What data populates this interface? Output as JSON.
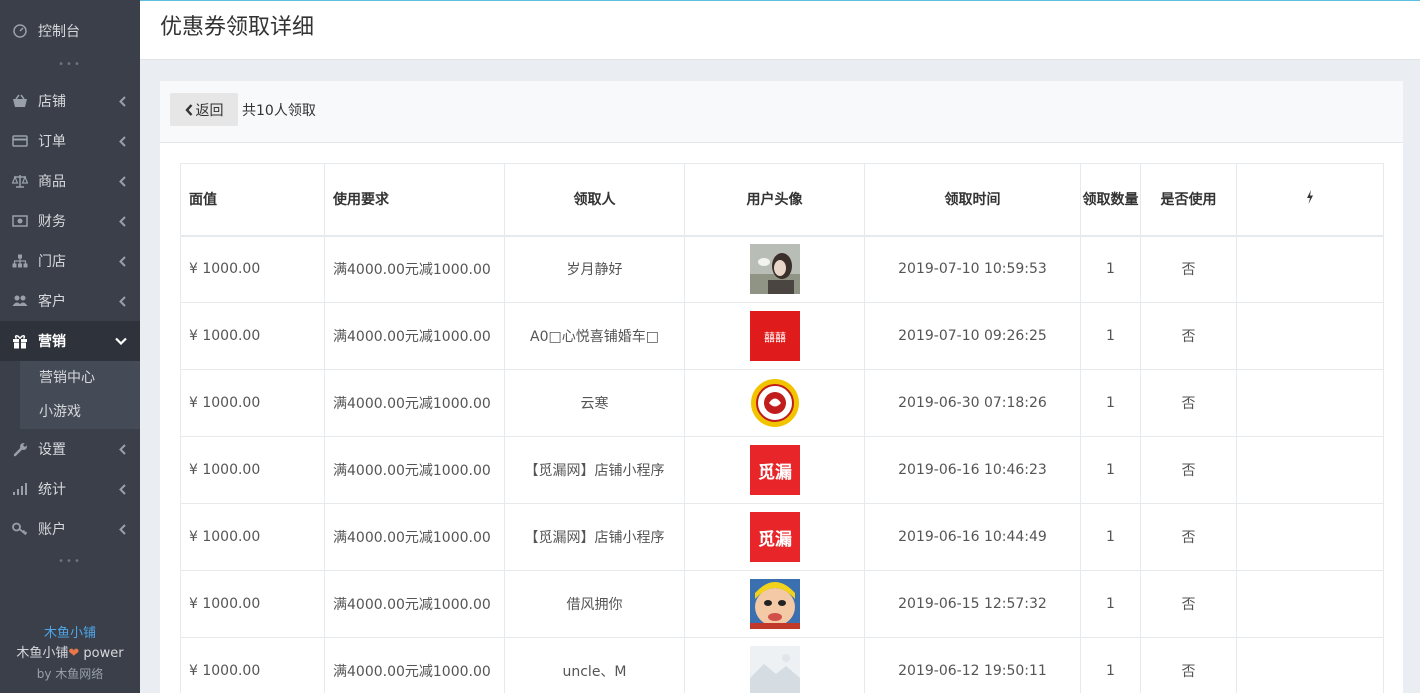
{
  "sidebar": {
    "dashboard": "控制台",
    "menu": [
      {
        "label": "店铺",
        "icon": "basket-icon"
      },
      {
        "label": "订单",
        "icon": "card-icon"
      },
      {
        "label": "商品",
        "icon": "scale-icon"
      },
      {
        "label": "财务",
        "icon": "money-icon"
      },
      {
        "label": "门店",
        "icon": "sitemap-icon"
      },
      {
        "label": "客户",
        "icon": "users-icon"
      },
      {
        "label": "营销",
        "icon": "gift-icon"
      },
      {
        "label": "设置",
        "icon": "wrench-icon"
      },
      {
        "label": "统计",
        "icon": "signal-icon"
      },
      {
        "label": "账户",
        "icon": "key-icon"
      }
    ],
    "submenu": [
      "营销中心",
      "小游戏"
    ],
    "footer": {
      "brand": "木鱼小铺",
      "power_prefix": "木鱼小铺",
      "power_suffix": " power",
      "by": "by 木鱼网络"
    }
  },
  "header": {
    "title": "优惠券领取详细"
  },
  "toolbar": {
    "back_label": "返回",
    "count_text": "共10人领取"
  },
  "table": {
    "headers": [
      "面值",
      "使用要求",
      "领取人",
      "用户头像",
      "领取时间",
      "领取数量",
      "是否使用"
    ],
    "rows": [
      {
        "value": "¥ 1000.00",
        "req": "满4000.00元减1000.00",
        "user": "岁月静好",
        "time": "2019-07-10 10:59:53",
        "qty": "1",
        "used": "否"
      },
      {
        "value": "¥ 1000.00",
        "req": "满4000.00元减1000.00",
        "user": "A0□心悦喜铺婚车□",
        "time": "2019-07-10 09:26:25",
        "qty": "1",
        "used": "否"
      },
      {
        "value": "¥ 1000.00",
        "req": "满4000.00元减1000.00",
        "user": "云寒",
        "time": "2019-06-30 07:18:26",
        "qty": "1",
        "used": "否"
      },
      {
        "value": "¥ 1000.00",
        "req": "满4000.00元减1000.00",
        "user": "【觅漏网】店铺小程序",
        "time": "2019-06-16 10:46:23",
        "qty": "1",
        "used": "否"
      },
      {
        "value": "¥ 1000.00",
        "req": "满4000.00元减1000.00",
        "user": "【觅漏网】店铺小程序",
        "time": "2019-06-16 10:44:49",
        "qty": "1",
        "used": "否"
      },
      {
        "value": "¥ 1000.00",
        "req": "满4000.00元减1000.00",
        "user": "借风拥你",
        "time": "2019-06-15 12:57:32",
        "qty": "1",
        "used": "否"
      },
      {
        "value": "¥ 1000.00",
        "req": "满4000.00元减1000.00",
        "user": "uncle、M",
        "time": "2019-06-12 19:50:11",
        "qty": "1",
        "used": "否"
      }
    ],
    "avatar_texts": {
      "xi": "囍囍",
      "milou": "觅漏"
    }
  },
  "colors": {
    "sidebar_bg": "#3a3f49",
    "price": "#e4393c",
    "brand": "#4fa6e8",
    "topbar_accent": "#5bc0de"
  }
}
